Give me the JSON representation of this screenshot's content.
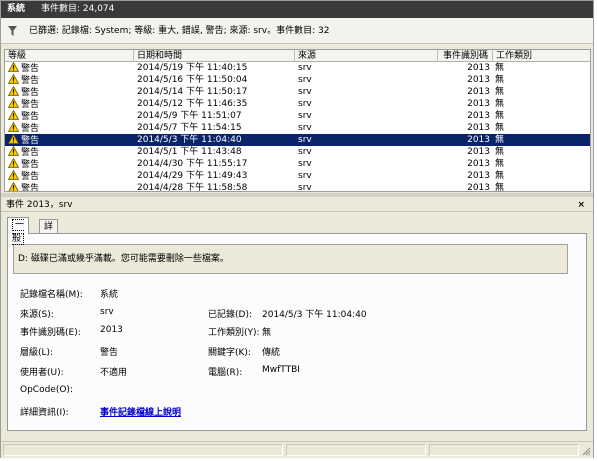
{
  "titlebar": {
    "log_name": "系統",
    "event_count": "事件數目: 24,074"
  },
  "filter": {
    "text": "已篩選: 記錄檔: System; 等級: 重大, 錯誤, 警告; 來源: srv。事件數目: 32"
  },
  "table": {
    "headers": {
      "level": "等級",
      "date": "日期和時間",
      "source": "來源",
      "event_id": "事件識別碼",
      "category": "工作類別"
    },
    "rows": [
      {
        "level": "警告",
        "date": "2014/5/19 下午 11:40:15",
        "source": "srv",
        "event_id": "2013",
        "category": "無"
      },
      {
        "level": "警告",
        "date": "2014/5/16 下午 11:50:04",
        "source": "srv",
        "event_id": "2013",
        "category": "無"
      },
      {
        "level": "警告",
        "date": "2014/5/14 下午 11:50:17",
        "source": "srv",
        "event_id": "2013",
        "category": "無"
      },
      {
        "level": "警告",
        "date": "2014/5/12 下午 11:46:35",
        "source": "srv",
        "event_id": "2013",
        "category": "無"
      },
      {
        "level": "警告",
        "date": "2014/5/9 下午 11:51:07",
        "source": "srv",
        "event_id": "2013",
        "category": "無"
      },
      {
        "level": "警告",
        "date": "2014/5/7 下午 11:54:15",
        "source": "srv",
        "event_id": "2013",
        "category": "無"
      },
      {
        "level": "警告",
        "date": "2014/5/3 下午 11:04:40",
        "source": "srv",
        "event_id": "2013",
        "category": "無"
      },
      {
        "level": "警告",
        "date": "2014/5/1 下午 11:43:48",
        "source": "srv",
        "event_id": "2013",
        "category": "無"
      },
      {
        "level": "警告",
        "date": "2014/4/30 下午 11:55:17",
        "source": "srv",
        "event_id": "2013",
        "category": "無"
      },
      {
        "level": "警告",
        "date": "2014/4/29 下午 11:49:43",
        "source": "srv",
        "event_id": "2013",
        "category": "無"
      },
      {
        "level": "警告",
        "date": "2014/4/28 下午 11:58:58",
        "source": "srv",
        "event_id": "2013",
        "category": "無"
      }
    ]
  },
  "detail": {
    "header": "事件 2013，srv",
    "close": "×",
    "tabs": {
      "general": "一般",
      "details": "詳細資料"
    },
    "message": "D: 磁碟已滿或幾乎滿載。您可能需要刪除一些檔案。",
    "fields": {
      "log_name_label": "記錄檔名稱(M):",
      "log_name_value": "系統",
      "source_label": "來源(S):",
      "source_value": "srv",
      "logged_label": "已記錄(D):",
      "logged_value": "2014/5/3 下午 11:04:40",
      "event_id_label": "事件識別碼(E):",
      "event_id_value": "2013",
      "task_label": "工作類別(Y):",
      "task_value": "無",
      "level_label": "層級(L):",
      "level_value": "警告",
      "keywords_label": "關鍵字(K):",
      "keywords_value": "傳統",
      "user_label": "使用者(U):",
      "user_value": "不適用",
      "computer_label": "電腦(R):",
      "computer_value": "MwfTTBI",
      "opcode_label": "OpCode(O):",
      "more_info_label": "詳細資訊(I):",
      "more_info_link": "事件記錄檔線上說明"
    }
  },
  "colors": {
    "selection": "#0a246a",
    "warning": "#f7c600",
    "link": "#0000cc",
    "titlebar": "#3a3a3a"
  },
  "icons": {
    "filter": "funnel-icon",
    "level": "warning-icon",
    "close": "close-icon",
    "resize": "resize-grip-icon"
  }
}
